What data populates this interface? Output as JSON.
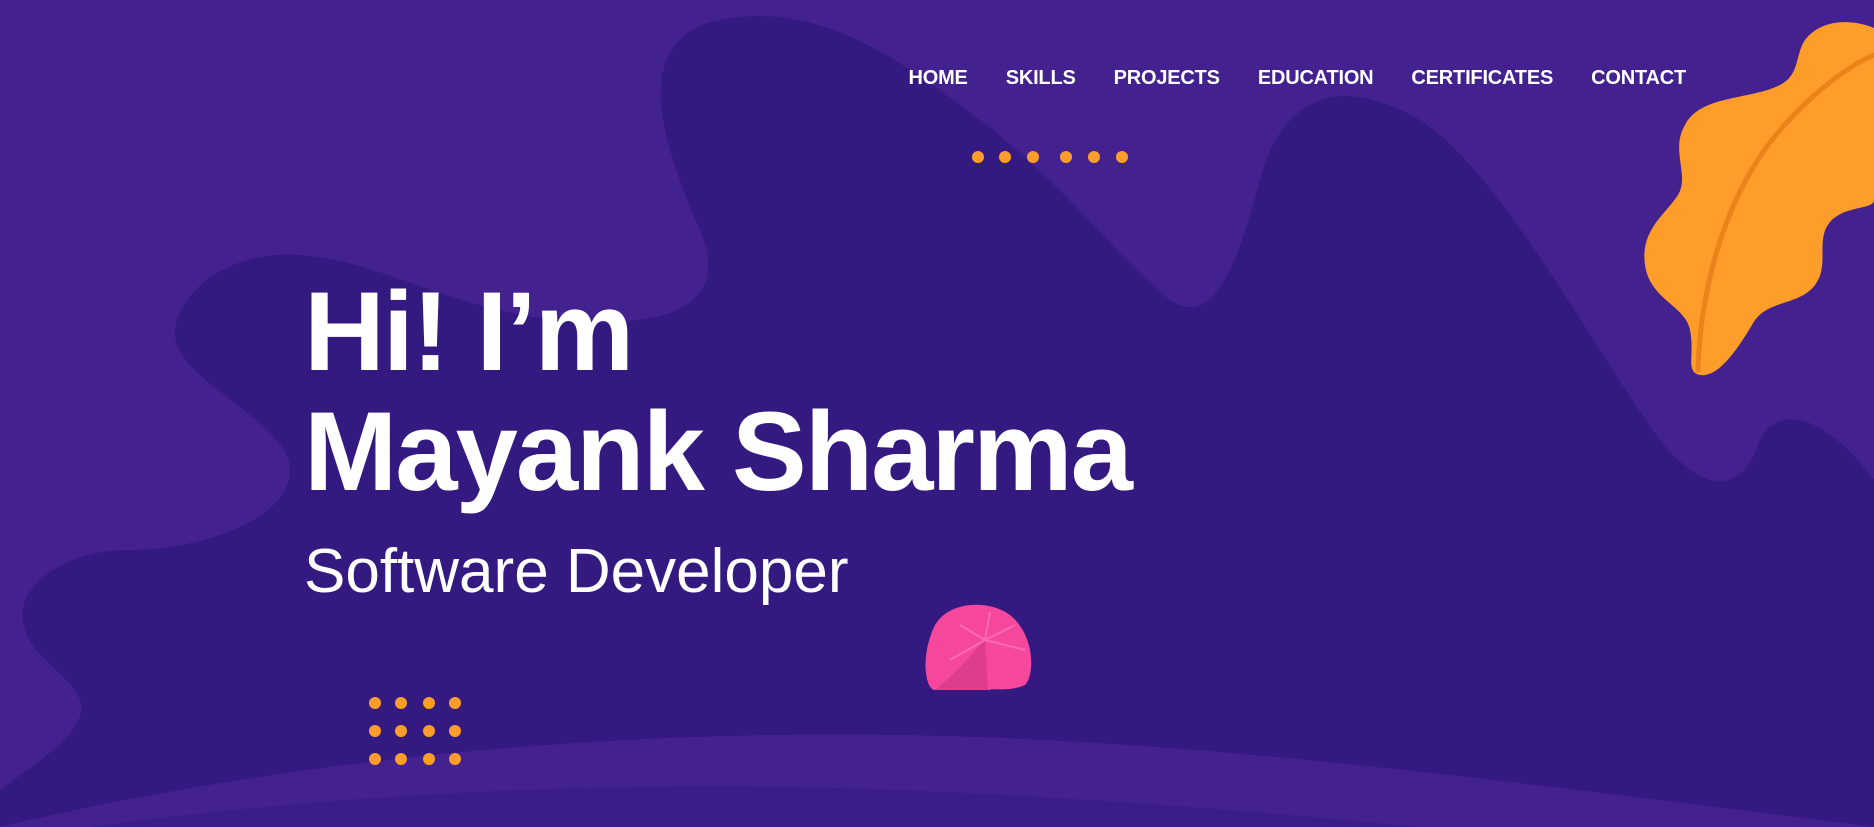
{
  "nav": {
    "items": [
      {
        "label": "HOME"
      },
      {
        "label": "SKILLS"
      },
      {
        "label": "PROJECTS"
      },
      {
        "label": "EDUCATION"
      },
      {
        "label": "CERTIFICATES"
      },
      {
        "label": "CONTACT"
      }
    ]
  },
  "hero": {
    "greeting": "Hi! I’m",
    "name": "Mayank Sharma",
    "role": "Software Developer"
  },
  "colors": {
    "background": "#43228f",
    "blob": "#341980",
    "accent_orange": "#ff9d2b",
    "accent_pink": "#f5479b",
    "text": "#ffffff"
  },
  "decorations": {
    "leaf": "leaf-icon",
    "flower": "pink-flower-icon",
    "dots": "dot-pattern"
  }
}
